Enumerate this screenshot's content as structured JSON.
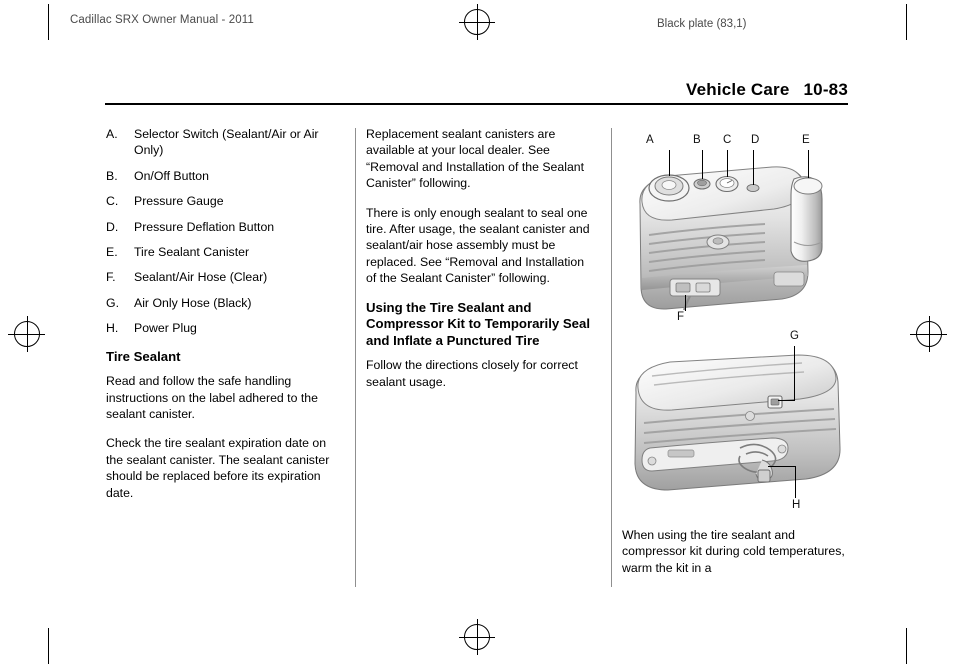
{
  "header": {
    "manual_title": "Cadillac SRX Owner Manual - 2011",
    "plate": "Black plate (83,1)",
    "section": "Vehicle Care",
    "page_number": "10-83"
  },
  "column_1": {
    "callouts": [
      {
        "key": "A.",
        "value": "Selector Switch (Sealant/Air or Air Only)"
      },
      {
        "key": "B.",
        "value": "On/Off Button"
      },
      {
        "key": "C.",
        "value": "Pressure Gauge"
      },
      {
        "key": "D.",
        "value": "Pressure Deflation Button"
      },
      {
        "key": "E.",
        "value": "Tire Sealant Canister"
      },
      {
        "key": "F.",
        "value": "Sealant/Air Hose (Clear)"
      },
      {
        "key": "G.",
        "value": "Air Only Hose (Black)"
      },
      {
        "key": "H.",
        "value": "Power Plug"
      }
    ],
    "heading": "Tire Sealant",
    "paragraph_1": "Read and follow the safe handling instructions on the label adhered to the sealant canister.",
    "paragraph_2": "Check the tire sealant expiration date on the sealant canister. The sealant canister should be replaced before its expiration date."
  },
  "column_2": {
    "paragraph_1": "Replacement sealant canisters are available at your local dealer. See “Removal and Installation of the Sealant Canister” following.",
    "paragraph_2": "There is only enough sealant to seal one tire. After usage, the sealant canister and sealant/air hose assembly must be replaced. See “Removal and Installation of the Sealant Canister” following.",
    "heading": "Using the Tire Sealant and Compressor Kit to Temporarily Seal and Inflate a Punctured Tire",
    "paragraph_3": "Follow the directions closely for correct sealant usage."
  },
  "column_3": {
    "figure_top_labels": [
      "A",
      "B",
      "C",
      "D",
      "E",
      "F"
    ],
    "figure_bottom_labels": [
      "G",
      "H"
    ],
    "caption": "When using the tire sealant and compressor kit during cold temperatures, warm the kit in a"
  },
  "colors": {
    "text": "#000000",
    "muted_text": "#4a4a4a",
    "rule": "#8f8f8f",
    "figure_light": "#f0f0f0",
    "figure_mid": "#c9c9c9",
    "figure_dark": "#8e8e8e"
  }
}
